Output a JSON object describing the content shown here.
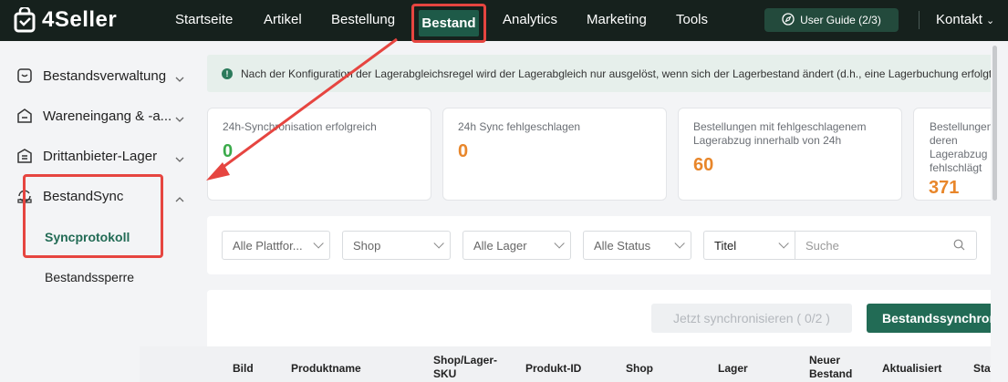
{
  "app": {
    "name": "4Seller"
  },
  "nav": {
    "items": [
      "Startseite",
      "Artikel",
      "Bestellung",
      "Bestand",
      "Analytics",
      "Marketing",
      "Tools"
    ],
    "active": "Bestand",
    "guide": "User Guide (2/3)",
    "contact": "Kontakt"
  },
  "sidebar": {
    "items": [
      {
        "label": "Bestandsverwaltung",
        "icon": "inventory-icon"
      },
      {
        "label": "Wareneingang & -a...",
        "icon": "inbound-icon"
      },
      {
        "label": "Drittanbieter-Lager",
        "icon": "warehouse-icon"
      },
      {
        "label": "BestandSync",
        "icon": "sync-icon"
      }
    ],
    "subitems": [
      "Syncprotokoll",
      "Bestandssperre"
    ]
  },
  "notice": {
    "text": "Nach der Konfiguration der Lagerabgleichsregel wird der Lagerabgleich nur ausgelöst, wenn sich der Lagerbestand ändert (d.h., eine Lagerbuchung erfolgt)."
  },
  "stats": [
    {
      "title": "24h-Synchronisation erfolgreich",
      "value": "0",
      "color": "#3aaa4a"
    },
    {
      "title": "24h Sync fehlgeschlagen",
      "value": "0",
      "color": "#e8862a"
    },
    {
      "title": "Bestellungen mit fehlgeschlagenem Lagerabzug innerhalb von 24h",
      "value": "60",
      "color": "#e8862a"
    },
    {
      "title": "Bestellungen, deren Lagerabzug fehlschlägt",
      "value": "371",
      "color": "#e8862a"
    }
  ],
  "filters": {
    "platform": "Alle Plattfor...",
    "shop": "Shop",
    "warehouse": "Alle Lager",
    "status": "Alle Status",
    "field": "Titel",
    "search_placeholder": "Suche"
  },
  "actions": {
    "sync_now": "Jetzt synchronisieren ( 0/2 )",
    "bulk_sync": "Bestandssynchronisierung"
  },
  "table": {
    "headers": [
      "Bild",
      "Produktname",
      "Shop/Lager-SKU",
      "Produkt-ID",
      "Shop",
      "Lager",
      "Neuer Bestand",
      "Aktualisiert",
      "Status"
    ]
  },
  "colors": {
    "accent": "#226b55",
    "annotation": "#e64540"
  }
}
